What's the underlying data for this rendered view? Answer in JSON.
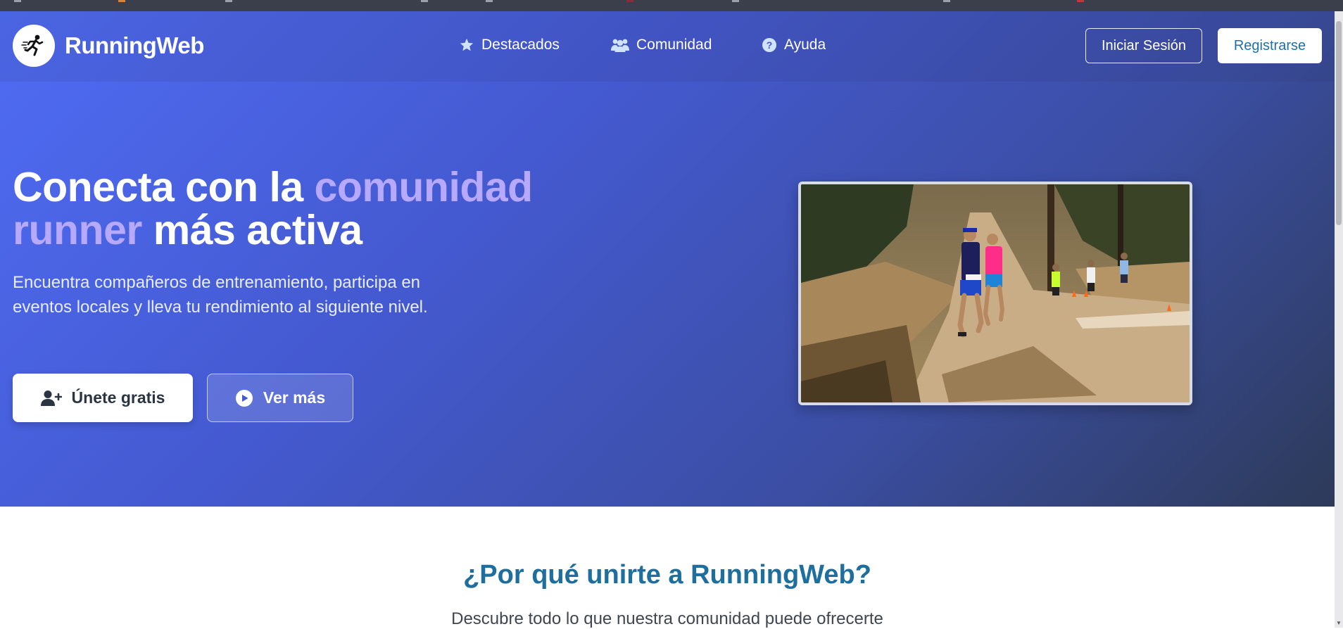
{
  "header": {
    "brand": "RunningWeb",
    "nav": [
      {
        "label": "Destacados",
        "icon": "star-icon"
      },
      {
        "label": "Comunidad",
        "icon": "users-icon"
      },
      {
        "label": "Ayuda",
        "icon": "question-circle-icon"
      }
    ],
    "login_label": "Iniciar Sesión",
    "register_label": "Registrarse"
  },
  "hero": {
    "title_part1": "Conecta con la ",
    "title_highlight": "comunidad runner",
    "title_part2": " más activa",
    "subtitle": "Encuentra compañeros de entrenamiento, participa en eventos locales y lleva tu rendimiento al siguiente nivel.",
    "primary_cta": "Únete gratis",
    "secondary_cta": "Ver más",
    "image": "trail-runners-photo"
  },
  "features": {
    "title": "¿Por qué unirte a RunningWeb?",
    "subtitle": "Descubre todo lo que nuestra comunidad puede ofrecerte"
  },
  "colors": {
    "hero_gradient_start": "#4f6cf4",
    "hero_gradient_end": "#2d3a59",
    "highlight": "#b7a9ff",
    "section_title": "#1e6f9e",
    "register_text": "#1f6fa8"
  }
}
